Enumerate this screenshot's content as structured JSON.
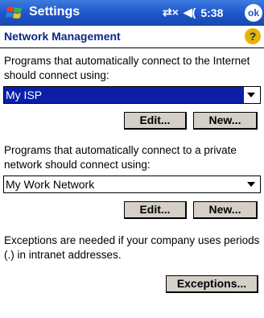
{
  "titlebar": {
    "title": "Settings",
    "time": "5:38",
    "ok_label": "ok",
    "icons": [
      "start-flag-icon",
      "connectivity-icon",
      "volume-icon"
    ]
  },
  "section": {
    "title": "Network Management",
    "help_label": "?"
  },
  "internet": {
    "description": "Programs that automatically connect to the Internet should connect using:",
    "selected": "My ISP",
    "edit_label": "Edit...",
    "new_label": "New..."
  },
  "private": {
    "description": "Programs that automatically connect to a private network should connect using:",
    "selected": "My Work Network",
    "edit_label": "Edit...",
    "new_label": "New..."
  },
  "exceptions": {
    "description": "Exceptions are needed if your company uses periods (.) in intranet addresses.",
    "button_label": "Exceptions..."
  },
  "colors": {
    "title_bar": "#1d55c8",
    "selection": "#0a1ea8",
    "button_face": "#d4d0c8",
    "section_title": "#0a2a82"
  }
}
